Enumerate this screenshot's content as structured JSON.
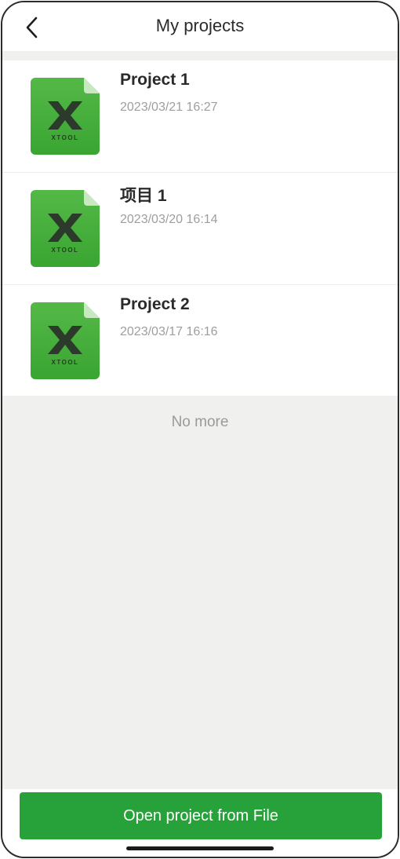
{
  "header": {
    "title": "My projects",
    "back_icon": "chevron-left-icon"
  },
  "projects": [
    {
      "name": "Project 1",
      "date": "2023/03/21 16:27",
      "icon": "xtool-file-icon",
      "icon_label": "XTOOL"
    },
    {
      "name": "项目 1",
      "date": "2023/03/20 16:14",
      "icon": "xtool-file-icon",
      "icon_label": "XTOOL"
    },
    {
      "name": "Project 2",
      "date": "2023/03/17 16:16",
      "icon": "xtool-file-icon",
      "icon_label": "XTOOL"
    }
  ],
  "list_footer": "No more",
  "bottom": {
    "open_button_label": "Open project from File"
  },
  "colors": {
    "accent": "#27a23a",
    "icon_green": "#45b03c",
    "background": "#f0f0ef"
  }
}
